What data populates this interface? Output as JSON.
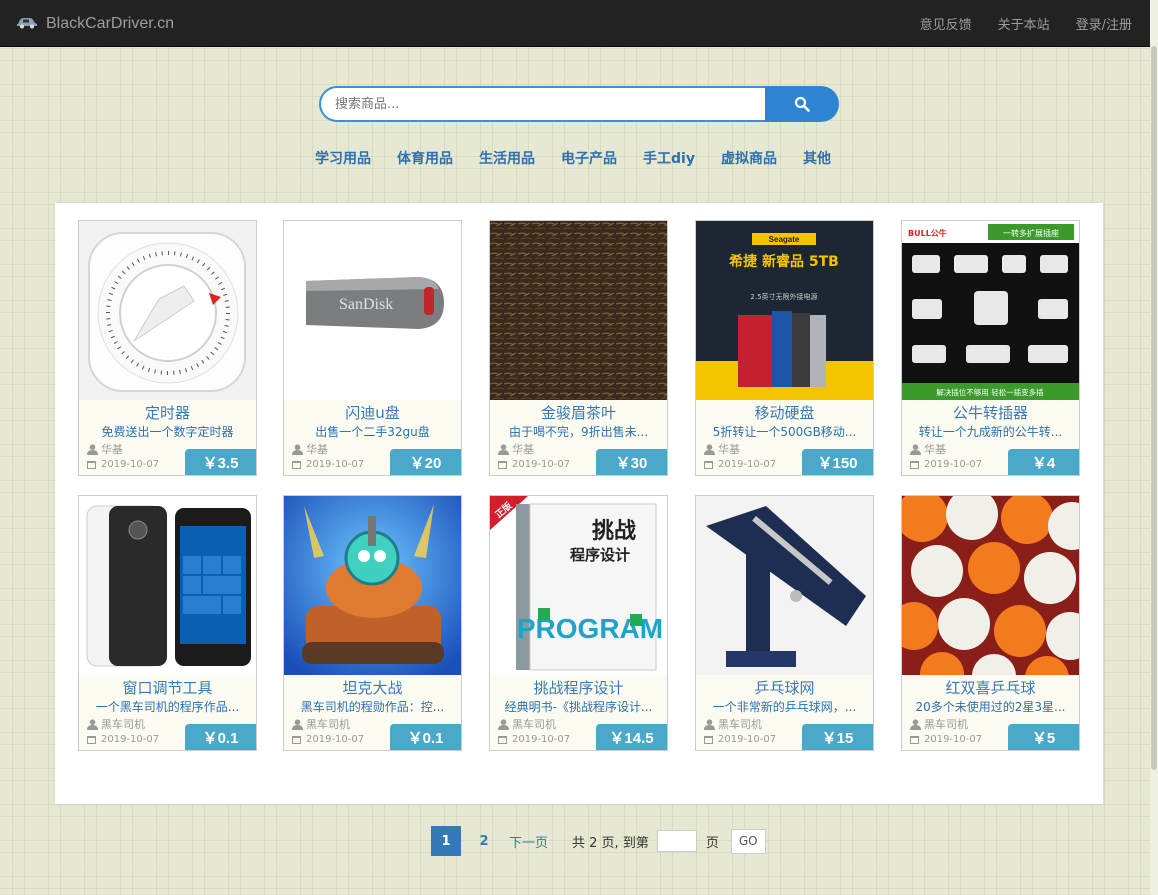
{
  "header": {
    "brand": "BlackCarDriver.cn",
    "links": [
      "意见反馈",
      "关于本站",
      "登录/注册"
    ]
  },
  "search": {
    "placeholder": "搜索商品..."
  },
  "categories": [
    "学习用品",
    "体育用品",
    "生活用品",
    "电子产品",
    "手工diy",
    "虚拟商品",
    "其他"
  ],
  "products": [
    {
      "title": "定时器",
      "desc": "免费送出一个数字定时器",
      "user": "华基",
      "date": "2019-10-07",
      "price": "￥3.5",
      "image": "timer"
    },
    {
      "title": "闪迪u盘",
      "desc": "出售一个二手32gu盘",
      "user": "华基",
      "date": "2019-10-07",
      "price": "￥20",
      "image": "usb"
    },
    {
      "title": "金骏眉茶叶",
      "desc": "由于喝不完，9折出售未...",
      "user": "华基",
      "date": "2019-10-07",
      "price": "￥30",
      "image": "tea"
    },
    {
      "title": "移动硬盘",
      "desc": "5折转让一个500GB移动...",
      "user": "华基",
      "date": "2019-10-07",
      "price": "￥150",
      "image": "hdd"
    },
    {
      "title": "公牛转插器",
      "desc": "转让一个九成新的公牛转...",
      "user": "华基",
      "date": "2019-10-07",
      "price": "￥4",
      "image": "plug"
    },
    {
      "title": "窗口调节工具",
      "desc": "一个黑车司机的程序作品...",
      "user": "黑车司机",
      "date": "2019-10-07",
      "price": "￥0.1",
      "image": "phone"
    },
    {
      "title": "坦克大战",
      "desc": "黑车司机的程勋作品：控...",
      "user": "黑车司机",
      "date": "2019-10-07",
      "price": "￥0.1",
      "image": "game"
    },
    {
      "title": "挑战程序设计",
      "desc": "经典明书-《挑战程序设计...",
      "user": "黑车司机",
      "date": "2019-10-07",
      "price": "￥14.5",
      "image": "book"
    },
    {
      "title": "乒乓球网",
      "desc": "一个非常新的乒乓球网，...",
      "user": "黑车司机",
      "date": "2019-10-07",
      "price": "￥15",
      "image": "net"
    },
    {
      "title": "红双喜乒乓球",
      "desc": "20多个未使用过的2星3星...",
      "user": "黑车司机",
      "date": "2019-10-07",
      "price": "￥5",
      "image": "balls"
    }
  ],
  "pagination": {
    "current": "1",
    "next_page": "2",
    "next_label": "下一页",
    "total_text": "共 2 页, 到第",
    "unit": "页",
    "go": "GO"
  },
  "image_text": {
    "usb_brand": "SanDisk",
    "hdd_brand": "Seagate",
    "hdd_line1": "希捷 新睿品 5TB",
    "hdd_line2": "2.5英寸无限外接电源",
    "plug_brand": "BULL公牛",
    "plug_banner": "一转多扩展插座",
    "plug_bottom": "解决插位不够用 轻松一插变多插",
    "book_tag": "正版",
    "book_title1": "挑战",
    "book_title2": "程序设计",
    "book_cover": "PROGRAM"
  },
  "colors": {
    "navbar": "#222222",
    "accent": "#2e86d3",
    "price_badge": "#4aa8c8",
    "category_link": "#2c70b0"
  }
}
